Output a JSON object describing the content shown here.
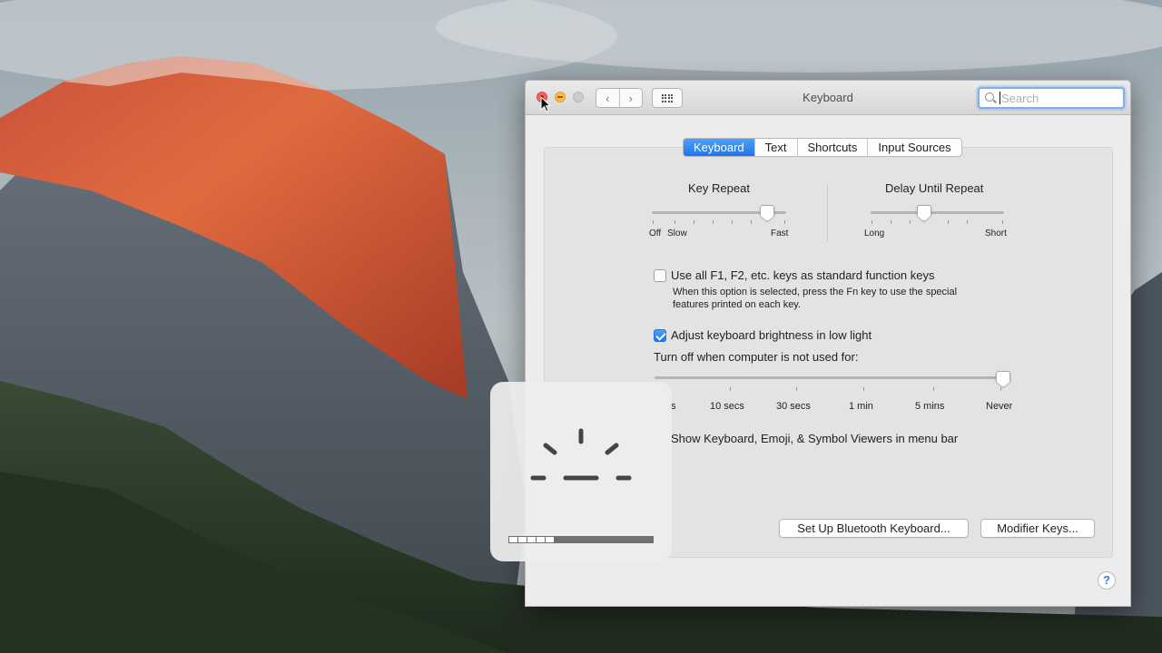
{
  "window": {
    "title": "Keyboard",
    "search_placeholder": "Search"
  },
  "nav": {
    "back_glyph": "‹",
    "forward_glyph": "›"
  },
  "tabs": [
    {
      "label": "Keyboard",
      "active": true
    },
    {
      "label": "Text",
      "active": false
    },
    {
      "label": "Shortcuts",
      "active": false
    },
    {
      "label": "Input Sources",
      "active": false
    }
  ],
  "key_repeat": {
    "title": "Key Repeat",
    "left_label": "Off",
    "left_label2": "Slow",
    "right_label": "Fast",
    "level": 0.86
  },
  "delay_until_repeat": {
    "title": "Delay Until Repeat",
    "left_label": "Long",
    "right_label": "Short",
    "level": 0.4
  },
  "function_keys": {
    "label": "Use all F1, F2, etc. keys as standard function keys",
    "checked": false,
    "description_line1": "When this option is selected, press the Fn key to use the special",
    "description_line2": "features printed on each key."
  },
  "brightness": {
    "label": "Adjust keyboard brightness in low light",
    "checked": true
  },
  "turn_off": {
    "label": "Turn off when computer is not used for:",
    "ticks": [
      "s",
      "10 secs",
      "30 secs",
      "1 min",
      "5 mins",
      "Never"
    ],
    "level": 1.0
  },
  "show_viewers": {
    "label": "Show Keyboard, Emoji, & Symbol Viewers in menu bar"
  },
  "buttons": {
    "bluetooth": "Set Up Bluetooth Keyboard...",
    "modifier": "Modifier Keys..."
  },
  "help_label": "?",
  "hud": {
    "type": "keyboard-brightness",
    "level_segments": 5,
    "total_segments": 16
  },
  "icons": {
    "search": "search-icon",
    "grid": "show-all-grid-icon",
    "brightness": "keyboard-brightness-icon",
    "cursor": "arrow-cursor-icon"
  },
  "colors": {
    "accent": "#1d75ef",
    "close": "#fc605c",
    "minimize": "#fdbc40"
  }
}
